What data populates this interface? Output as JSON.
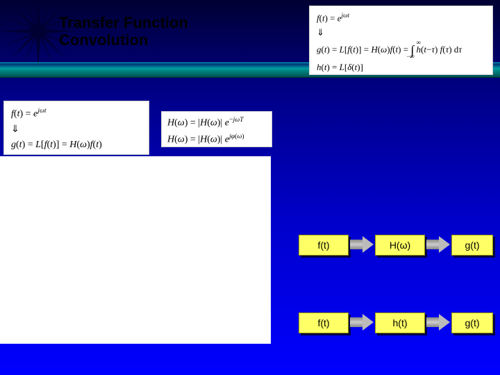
{
  "title": {
    "line1": "Transfer Function",
    "line2": "Convolution"
  },
  "eq_topright": {
    "line1": "f(t) = e^{jωt}",
    "line2": "⇓",
    "line3": "g(t) = L[f(t)] = H(ω) f(t) = ∫₋∞^∞ h(t−τ) f(τ) dτ",
    "line4": "h(t) = L[δ(t)]"
  },
  "eq_left": {
    "line1": "f(t) = e^{jωt}",
    "line2": "⇓",
    "line3": "g(t) = L[f(t)] = H(ω) f(t)"
  },
  "eq_mid": {
    "line1": "H(ω) = |H(ω)| e^{−jωT}",
    "line2": "H(ω) = |H(ω)| e^{jφ(ω)}"
  },
  "flow1": {
    "in": "f(t)",
    "sys": "H(ω)",
    "out": "g(t)"
  },
  "flow2": {
    "in": "f(t)",
    "sys": "h(t)",
    "out": "g(t)"
  }
}
